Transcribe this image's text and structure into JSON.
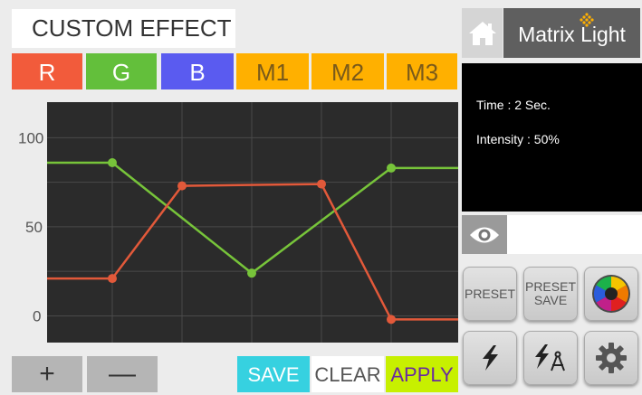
{
  "header": {
    "title": "CUSTOM EFFECT"
  },
  "channels": [
    {
      "label": "R"
    },
    {
      "label": "G"
    },
    {
      "label": "B"
    },
    {
      "label": "M1"
    },
    {
      "label": "M2"
    },
    {
      "label": "M3"
    }
  ],
  "brand": {
    "name": "Matrix Light"
  },
  "info": {
    "time": "Time : 2 Sec.",
    "intensity": "Intensity : 50%"
  },
  "buttons": {
    "plus": "+",
    "minus": "—",
    "save": "SAVE",
    "clear": "CLEAR",
    "apply": "APPLY",
    "preset": "PRESET",
    "preset_save_line1": "PRESET",
    "preset_save_line2": "SAVE"
  },
  "colors": {
    "red": "#f25b3b",
    "green": "#63bf3b",
    "blue": "#5a5bf0",
    "amber": "#ffb000",
    "cyan": "#36d1e0",
    "lime": "#c7f000"
  },
  "icons": [
    "home-icon",
    "logo-icon",
    "eye-icon",
    "color-wheel-icon",
    "lightning-icon",
    "lightning-compass-icon",
    "gear-icon"
  ],
  "chart_data": {
    "type": "line",
    "y_ticks": [
      "100",
      "50",
      "0"
    ],
    "ylim": [
      -15,
      120
    ],
    "x": [
      0,
      1,
      2,
      3,
      4,
      5,
      6
    ],
    "grid": true,
    "series": [
      {
        "color": "#77c43a",
        "values": [
          86,
          86,
          null,
          24,
          null,
          83,
          83
        ]
      },
      {
        "color": "#e2593a",
        "values": [
          21,
          21,
          73,
          null,
          74,
          -2,
          -2
        ]
      }
    ],
    "points": [
      {
        "series": 0,
        "x": 1,
        "y": 86
      },
      {
        "series": 0,
        "x": 3,
        "y": 24
      },
      {
        "series": 0,
        "x": 5,
        "y": 83
      },
      {
        "series": 1,
        "x": 1,
        "y": 21
      },
      {
        "series": 1,
        "x": 2,
        "y": 73
      },
      {
        "series": 1,
        "x": 4,
        "y": 74
      },
      {
        "series": 1,
        "x": 5,
        "y": -2
      }
    ]
  }
}
